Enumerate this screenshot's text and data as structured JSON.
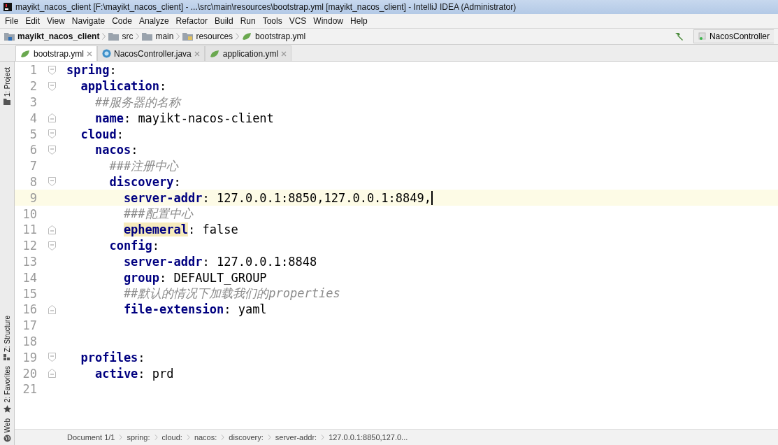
{
  "window": {
    "title": "mayikt_nacos_client [F:\\mayikt_nacos_client] - ...\\src\\main\\resources\\bootstrap.yml [mayikt_nacos_client] - IntelliJ IDEA (Administrator)"
  },
  "menu": [
    "File",
    "Edit",
    "View",
    "Navigate",
    "Code",
    "Analyze",
    "Refactor",
    "Build",
    "Run",
    "Tools",
    "VCS",
    "Window",
    "Help"
  ],
  "navbar": {
    "crumbs": [
      {
        "kind": "project",
        "label": "mayikt_nacos_client"
      },
      {
        "kind": "folder",
        "label": "src"
      },
      {
        "kind": "folder",
        "label": "main"
      },
      {
        "kind": "resources",
        "label": "resources"
      },
      {
        "kind": "yaml",
        "label": "bootstrap.yml"
      }
    ],
    "run_config": "NacosController"
  },
  "tabs": [
    {
      "label": "bootstrap.yml",
      "kind": "yaml",
      "selected": true
    },
    {
      "label": "NacosController.java",
      "kind": "java",
      "selected": false
    },
    {
      "label": "application.yml",
      "kind": "yaml",
      "selected": false
    }
  ],
  "tool_strip": [
    {
      "label": "1: Project",
      "kind": "folder"
    },
    {
      "label": "Z: Structure",
      "kind": "structure"
    },
    {
      "label": "2: Favorites",
      "kind": "star"
    },
    {
      "label": "Web",
      "kind": "globe"
    }
  ],
  "editor": {
    "lines": [
      {
        "number": "1",
        "fold_start": true,
        "fold_end": false,
        "current": false,
        "tokens": [
          {
            "kind": "key",
            "text": "spring"
          },
          {
            "kind": "punct",
            "text": ":"
          }
        ],
        "children": [
          {
            "number": "2",
            "fold_start": true,
            "fold_end": false,
            "current": false,
            "tokens": [
              {
                "kind": "key",
                "text": "application"
              },
              {
                "kind": "punct",
                "text": ":"
              }
            ],
            "children": [
              {
                "number": "3",
                "fold_start": false,
                "fold_end": false,
                "current": false,
                "tokens": [
                  {
                    "kind": "comment",
                    "text": "##服务器的名称"
                  }
                ]
              },
              {
                "number": "4",
                "fold_start": false,
                "fold_end": true,
                "current": false,
                "tokens": [
                  {
                    "kind": "key",
                    "text": "name"
                  },
                  {
                    "kind": "punct",
                    "text": ": "
                  },
                  {
                    "kind": "value",
                    "text": "mayikt-nacos-client"
                  }
                ]
              }
            ]
          },
          {
            "number": "5",
            "fold_start": true,
            "fold_end": false,
            "current": false,
            "tokens": [
              {
                "kind": "key",
                "text": "cloud"
              },
              {
                "kind": "punct",
                "text": ":"
              }
            ],
            "children": [
              {
                "number": "6",
                "fold_start": true,
                "fold_end": false,
                "current": false,
                "tokens": [
                  {
                    "kind": "key",
                    "text": "nacos"
                  },
                  {
                    "kind": "punct",
                    "text": ":"
                  }
                ],
                "children": [
                  {
                    "number": "7",
                    "fold_start": false,
                    "fold_end": false,
                    "current": false,
                    "tokens": [
                      {
                        "kind": "comment",
                        "text": "###注册中心"
                      }
                    ]
                  },
                  {
                    "number": "8",
                    "fold_start": true,
                    "fold_end": false,
                    "current": false,
                    "tokens": [
                      {
                        "kind": "key",
                        "text": "discovery"
                      },
                      {
                        "kind": "punct",
                        "text": ":"
                      }
                    ],
                    "children": [
                      {
                        "number": "9",
                        "fold_start": false,
                        "fold_end": false,
                        "current": true,
                        "tokens": [
                          {
                            "kind": "key",
                            "text": "server-addr"
                          },
                          {
                            "kind": "punct",
                            "text": ": "
                          },
                          {
                            "kind": "value",
                            "text": "127.0.0.1:8850,127.0.0.1:8849,"
                          }
                        ]
                      },
                      {
                        "number": "10",
                        "fold_start": false,
                        "fold_end": false,
                        "current": false,
                        "tokens": [
                          {
                            "kind": "comment",
                            "text": "###配置中心"
                          }
                        ]
                      },
                      {
                        "number": "11",
                        "fold_start": false,
                        "fold_end": true,
                        "current": false,
                        "tokens": [
                          {
                            "kind": "marked-key",
                            "text": "ephemeral"
                          },
                          {
                            "kind": "punct",
                            "text": ": "
                          },
                          {
                            "kind": "value",
                            "text": "false"
                          }
                        ]
                      }
                    ]
                  },
                  {
                    "number": "12",
                    "fold_start": true,
                    "fold_end": false,
                    "current": false,
                    "tokens": [
                      {
                        "kind": "key",
                        "text": "config"
                      },
                      {
                        "kind": "punct",
                        "text": ":"
                      }
                    ],
                    "children": [
                      {
                        "number": "13",
                        "fold_start": false,
                        "fold_end": false,
                        "current": false,
                        "tokens": [
                          {
                            "kind": "key",
                            "text": "server-addr"
                          },
                          {
                            "kind": "punct",
                            "text": ": "
                          },
                          {
                            "kind": "value",
                            "text": "127.0.0.1:8848"
                          }
                        ]
                      },
                      {
                        "number": "14",
                        "fold_start": false,
                        "fold_end": false,
                        "current": false,
                        "tokens": [
                          {
                            "kind": "key",
                            "text": "group"
                          },
                          {
                            "kind": "punct",
                            "text": ": "
                          },
                          {
                            "kind": "value",
                            "text": "DEFAULT_GROUP"
                          }
                        ]
                      },
                      {
                        "number": "15",
                        "fold_start": false,
                        "fold_end": false,
                        "current": false,
                        "tokens": [
                          {
                            "kind": "comment",
                            "text": "##默认的情况下加载我们的properties"
                          }
                        ]
                      },
                      {
                        "number": "16",
                        "fold_start": false,
                        "fold_end": true,
                        "current": false,
                        "tokens": [
                          {
                            "kind": "key",
                            "text": "file-extension"
                          },
                          {
                            "kind": "punct",
                            "text": ": "
                          },
                          {
                            "kind": "value",
                            "text": "yaml"
                          }
                        ]
                      }
                    ]
                  }
                ]
              }
            ]
          },
          {
            "number": "17",
            "fold_start": false,
            "fold_end": false,
            "current": false
          },
          {
            "number": "18",
            "fold_start": false,
            "fold_end": false,
            "current": false
          },
          {
            "number": "19",
            "fold_start": true,
            "fold_end": false,
            "current": false,
            "tokens": [
              {
                "kind": "key",
                "text": "profiles"
              },
              {
                "kind": "punct",
                "text": ":"
              }
            ],
            "children": [
              {
                "number": "20",
                "fold_start": false,
                "fold_end": true,
                "current": false,
                "tokens": [
                  {
                    "kind": "key",
                    "text": "active"
                  },
                  {
                    "kind": "punct",
                    "text": ": "
                  },
                  {
                    "kind": "value",
                    "text": "prd"
                  }
                ]
              }
            ]
          }
        ]
      },
      {
        "number": "21",
        "fold_start": false,
        "fold_end": false,
        "current": false
      }
    ]
  },
  "status_bar": {
    "document": "Document 1/1",
    "path": [
      "spring:",
      "cloud:",
      "nacos:",
      "discovery:",
      "server-addr:",
      "127.0.0.1:8850,127.0..."
    ]
  }
}
